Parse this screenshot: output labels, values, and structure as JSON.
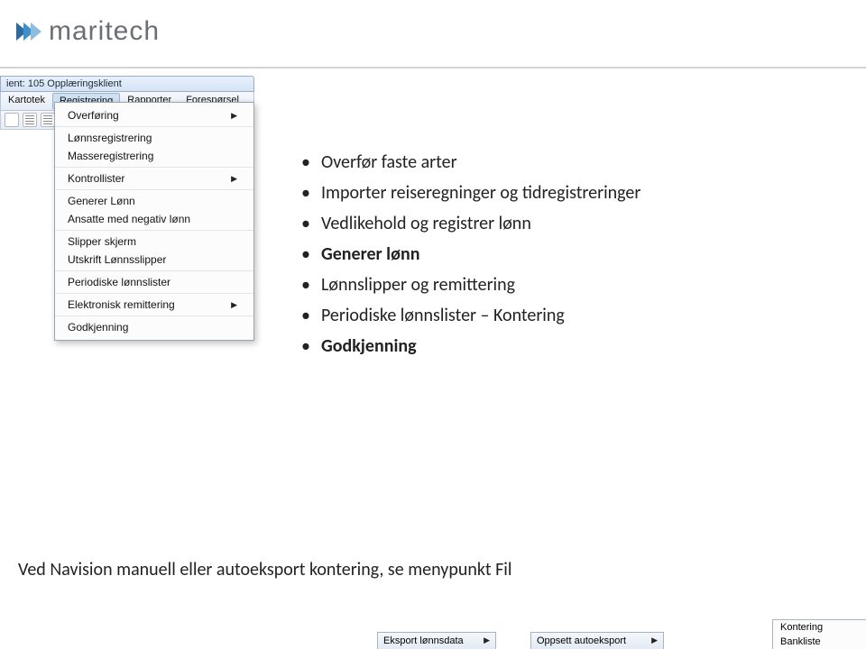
{
  "logo": {
    "text": "maritech"
  },
  "window": {
    "title": "ient: 105 Opplæringsklient",
    "menus": [
      "Kartotek",
      "Registrering",
      "Rapporter",
      "Forespørsel"
    ],
    "selected_menu_index": 1,
    "dropdown": {
      "groups": [
        [
          {
            "label": "Overføring",
            "submenu": true
          }
        ],
        [
          {
            "label": "Lønnsregistrering",
            "submenu": false
          },
          {
            "label": "Masseregistrering",
            "submenu": false
          }
        ],
        [
          {
            "label": "Kontrollister",
            "submenu": true
          }
        ],
        [
          {
            "label": "Generer Lønn",
            "submenu": false
          },
          {
            "label": "Ansatte med negativ lønn",
            "submenu": false
          }
        ],
        [
          {
            "label": "Slipper skjerm",
            "submenu": false
          },
          {
            "label": "Utskrift Lønnsslipper",
            "submenu": false
          }
        ],
        [
          {
            "label": "Periodiske lønnslister",
            "submenu": false
          }
        ],
        [
          {
            "label": "Elektronisk remittering",
            "submenu": true
          }
        ],
        [
          {
            "label": "Godkjenning",
            "submenu": false
          }
        ]
      ]
    }
  },
  "bullets": [
    {
      "text": "Overfør faste arter",
      "bold": false
    },
    {
      "text": "Importer reiseregninger og tidregistreringer",
      "bold": false
    },
    {
      "text": "Vedlikehold og registrer lønn",
      "bold": false
    },
    {
      "text": "Generer lønn",
      "bold": true
    },
    {
      "text": "Lønnslipper og remittering",
      "bold": false
    },
    {
      "text": "Periodiske lønnslister – Kontering",
      "bold": false
    },
    {
      "text": "Godkjenning",
      "bold": true
    }
  ],
  "caption": "Ved Navision manuell eller autoeksport kontering, se menypunkt Fil",
  "bottom": {
    "frag1": "Eksport lønnsdata",
    "frag2": "Oppsett autoeksport",
    "frag3": [
      "Kontering",
      "Bankliste"
    ]
  }
}
